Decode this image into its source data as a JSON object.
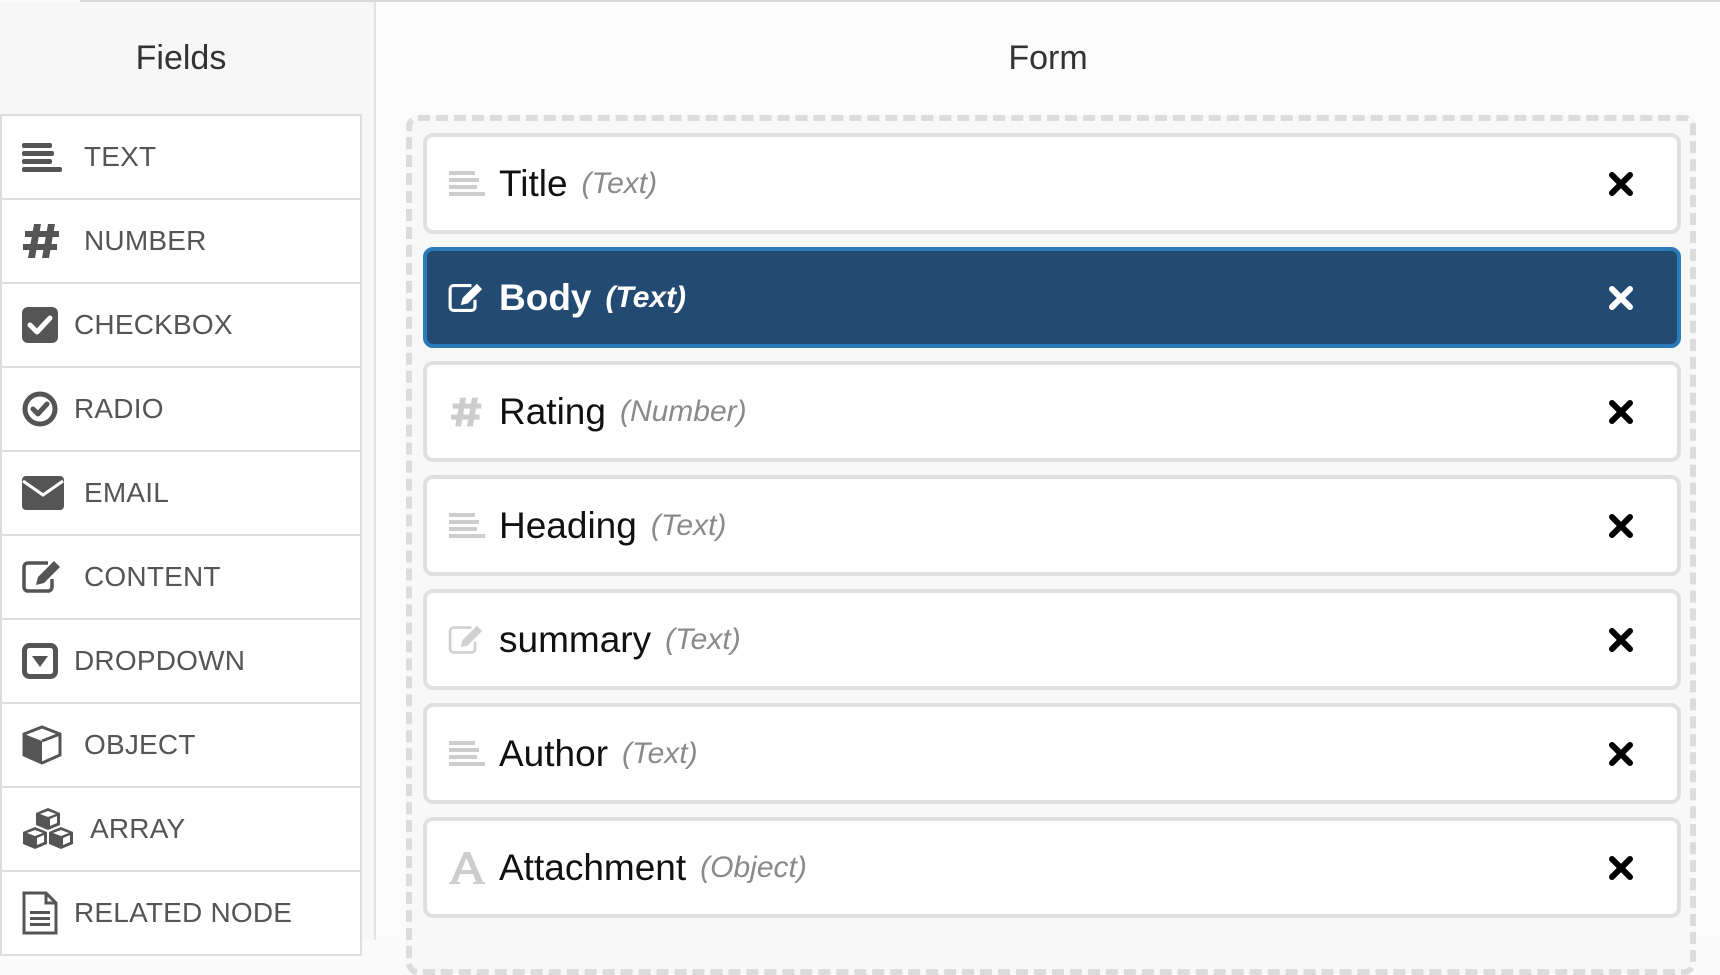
{
  "sidebar": {
    "title": "Fields",
    "items": [
      {
        "label": "TEXT",
        "icon": "text-lines-icon"
      },
      {
        "label": "NUMBER",
        "icon": "hash-icon"
      },
      {
        "label": "CHECKBOX",
        "icon": "checkbox-icon"
      },
      {
        "label": "RADIO",
        "icon": "radio-check-icon"
      },
      {
        "label": "EMAIL",
        "icon": "envelope-icon"
      },
      {
        "label": "CONTENT",
        "icon": "edit-icon"
      },
      {
        "label": "DROPDOWN",
        "icon": "dropdown-icon"
      },
      {
        "label": "OBJECT",
        "icon": "cube-icon"
      },
      {
        "label": "ARRAY",
        "icon": "cubes-icon"
      },
      {
        "label": "RELATED NODE",
        "icon": "document-icon"
      }
    ]
  },
  "form": {
    "title": "Form",
    "items": [
      {
        "name": "Title",
        "type": "(Text)",
        "icon": "text-lines-icon",
        "selected": false
      },
      {
        "name": "Body",
        "type": "(Text)",
        "icon": "edit-icon",
        "selected": true
      },
      {
        "name": "Rating",
        "type": "(Number)",
        "icon": "hash-icon",
        "selected": false
      },
      {
        "name": "Heading",
        "type": "(Text)",
        "icon": "text-lines-icon",
        "selected": false
      },
      {
        "name": "summary",
        "type": "(Text)",
        "icon": "edit-icon",
        "selected": false
      },
      {
        "name": "Author",
        "type": "(Text)",
        "icon": "text-lines-icon",
        "selected": false
      },
      {
        "name": "Attachment",
        "type": "(Object)",
        "icon": "font-a-icon",
        "selected": false
      }
    ]
  },
  "colors": {
    "selected_bg": "#234a72",
    "selected_border": "#2b7bb9",
    "icon_dark": "#555555",
    "icon_muted": "#c8c8c8"
  }
}
